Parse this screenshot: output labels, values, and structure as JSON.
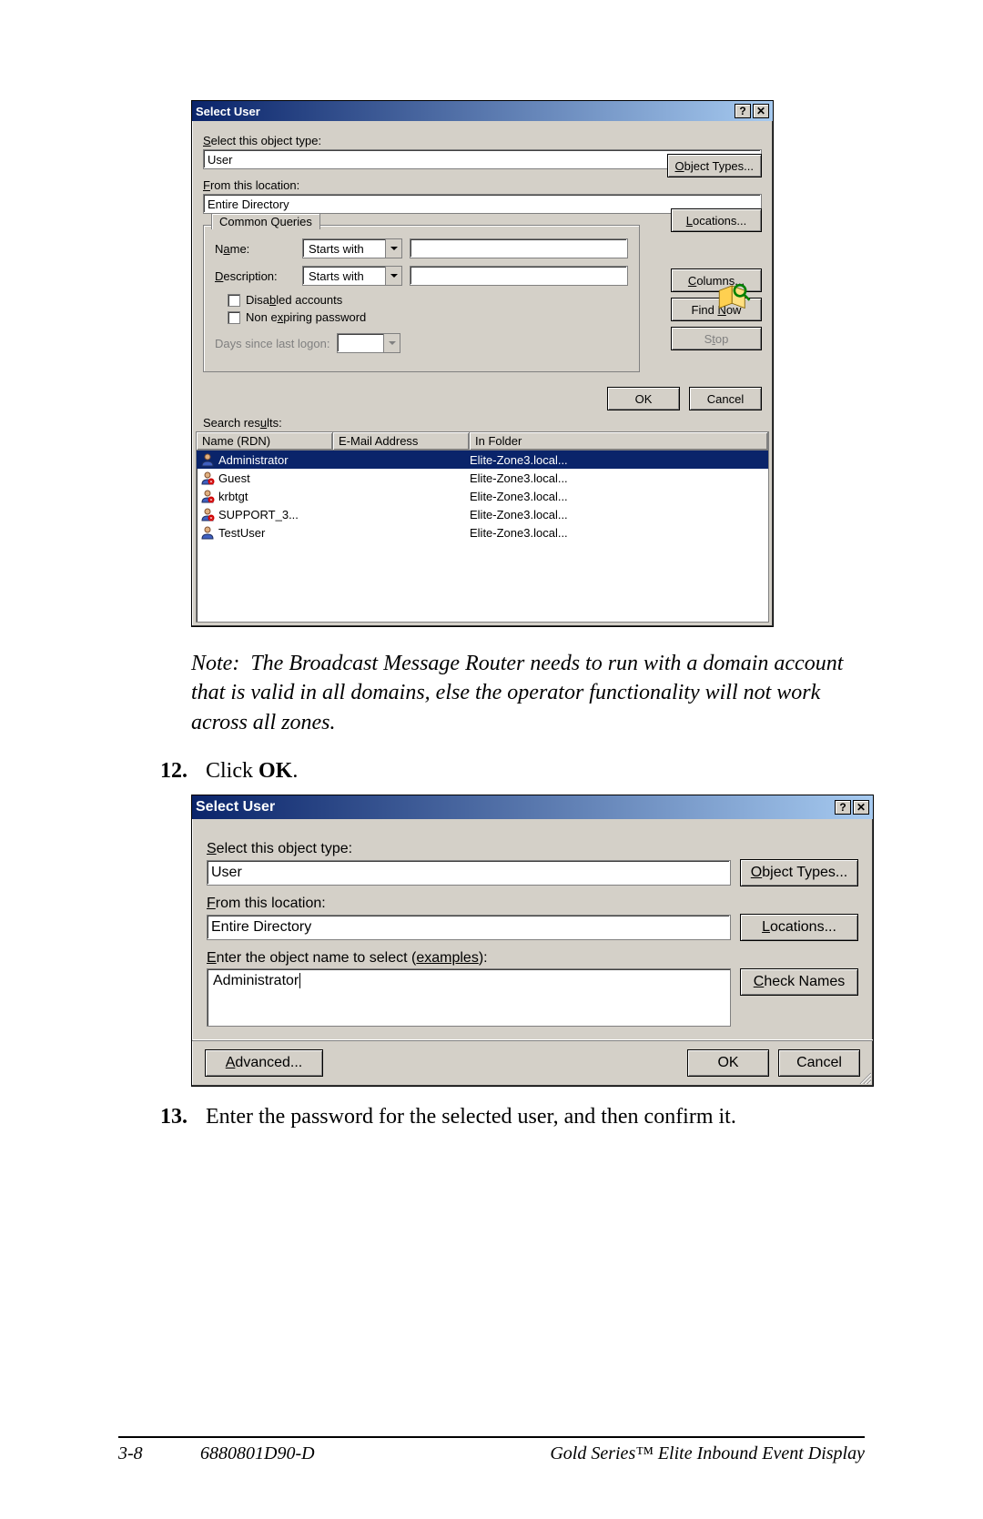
{
  "dlg1": {
    "title": "Select User",
    "select_type_label": "Select this object type:",
    "object_type_value": "User",
    "object_types_btn": "Object Types...",
    "from_location_label": "From this location:",
    "location_value": "Entire Directory",
    "locations_btn": "Locations...",
    "common_queries_tab": "Common Queries",
    "name_label": "Name:",
    "name_op": "Starts with",
    "desc_label": "Description:",
    "desc_op": "Starts with",
    "disabled_label": "Disabled accounts",
    "nonexp_label": "Non expiring password",
    "days_label": "Days since last logon:",
    "columns_btn": "Columns...",
    "find_now_btn": "Find Now",
    "stop_btn": "Stop",
    "ok_btn": "OK",
    "cancel_btn": "Cancel",
    "search_results_label": "Search results:",
    "cols": {
      "name": "Name (RDN)",
      "email": "E-Mail Address",
      "folder": "In Folder"
    },
    "rows": [
      {
        "name": "Administrator",
        "email": "",
        "folder": "Elite-Zone3.local...",
        "selected": true,
        "disabled": false
      },
      {
        "name": "Guest",
        "email": "",
        "folder": "Elite-Zone3.local...",
        "selected": false,
        "disabled": true
      },
      {
        "name": "krbtgt",
        "email": "",
        "folder": "Elite-Zone3.local...",
        "selected": false,
        "disabled": true
      },
      {
        "name": "SUPPORT_3...",
        "email": "",
        "folder": "Elite-Zone3.local...",
        "selected": false,
        "disabled": true
      },
      {
        "name": "TestUser",
        "email": "",
        "folder": "Elite-Zone3.local...",
        "selected": false,
        "disabled": false
      }
    ]
  },
  "note": {
    "label": "Note:",
    "text": "The Broadcast Message Router needs to run with a domain account that is valid in all domains, else the operator functionality will not work across all zones."
  },
  "step12": {
    "num": "12.",
    "text_prefix": "Click ",
    "bold": "OK",
    "text_suffix": "."
  },
  "dlg2": {
    "title": "Select User",
    "select_type_label": "Select this object type:",
    "object_type_value": "User",
    "object_types_btn": "Object Types...",
    "from_location_label": "From this location:",
    "location_value": "Entire Directory",
    "locations_btn": "Locations...",
    "enter_name_label_prefix": "Enter the object name to select (",
    "examples_link": "examples",
    "enter_name_label_suffix": "):",
    "object_name_value": "Administrator",
    "check_names_btn": "Check Names",
    "advanced_btn": "Advanced...",
    "ok_btn": "OK",
    "cancel_btn": "Cancel"
  },
  "step13": {
    "num": "13.",
    "text": "Enter the password for the selected user, and then confirm it."
  },
  "footer": {
    "page": "3-8",
    "docnum": "6880801D90-D",
    "product": "Gold Series™ Elite Inbound Event Display"
  }
}
